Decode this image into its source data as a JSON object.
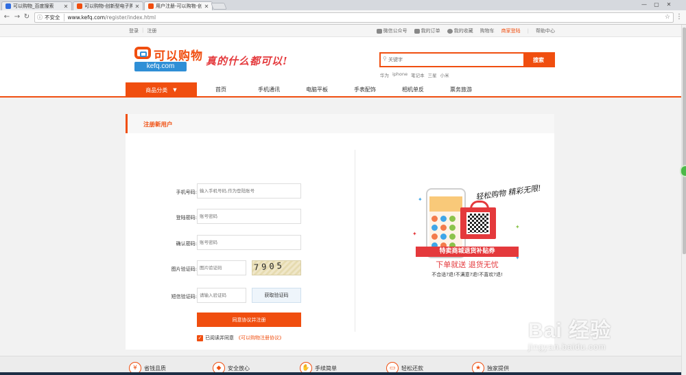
{
  "browser": {
    "tabs": [
      {
        "title": "可以购物_百度搜索",
        "active": false,
        "favicon_color": "#2f6ce0"
      },
      {
        "title": "可以购物-创新型电子购物",
        "active": false,
        "favicon_color": "#f04e0f"
      },
      {
        "title": "用户注册-可以购物-创新",
        "active": true,
        "favicon_color": "#f04e0f"
      }
    ],
    "security_label": "不安全",
    "url_host": "www.kefq.com",
    "url_path": "/register/index.html"
  },
  "topbar": {
    "login": "登录",
    "register": "注册",
    "wechat": "微信公众号",
    "my_orders": "我的订单",
    "my_favorites": "我的收藏",
    "cart": "购物车",
    "merchant_login": "商家登陆",
    "help": "帮助中心"
  },
  "header": {
    "brand": "可以购物",
    "domain": "kefq.com",
    "slogan": "真的什么都可以!",
    "search_placeholder": "关键字",
    "search_button": "搜索",
    "hot_words": [
      "华为",
      "iphone",
      "笔记本",
      "三星",
      "小米"
    ]
  },
  "nav": {
    "category": "商品分类",
    "links": [
      "首页",
      "手机通讯",
      "电脑平板",
      "手表配饰",
      "相机单反",
      "票务旅游"
    ]
  },
  "register": {
    "heading": "注册新用户",
    "phone_label": "手机号码:",
    "phone_placeholder": "输入手机号码,作为登陆账号",
    "password_label": "登陆密码:",
    "password_placeholder": "账号密码",
    "confirm_label": "确认密码:",
    "confirm_placeholder": "账号密码",
    "captcha_label": "图片验证码:",
    "captcha_placeholder": "图片验证码",
    "captcha_text": "7905",
    "sms_label": "短信验证码:",
    "sms_placeholder": "请输入验证码",
    "sms_button": "获取验证码",
    "submit": "同意协议并注册",
    "agree_prefix": "已阅读并同意",
    "agree_link": "《可以购物注册协议》"
  },
  "promo": {
    "script_text": "轻松购物 精彩无限!",
    "ribbon": "特卖商城退货补贴券",
    "line2": "下单就送  退货无忧",
    "line3": "不合适?退!不满意?退!不喜欢?退!"
  },
  "footer": {
    "items": [
      "省钱且质",
      "安全放心",
      "手续简单",
      "轻松还款",
      "独家提供"
    ]
  },
  "watermark": {
    "main": "Bai 经验",
    "sub": "jingyan.baidu.com"
  },
  "colors": {
    "accent": "#f04e0f",
    "brand_blue": "#2f8fd6",
    "promo_red": "#e4393c"
  }
}
